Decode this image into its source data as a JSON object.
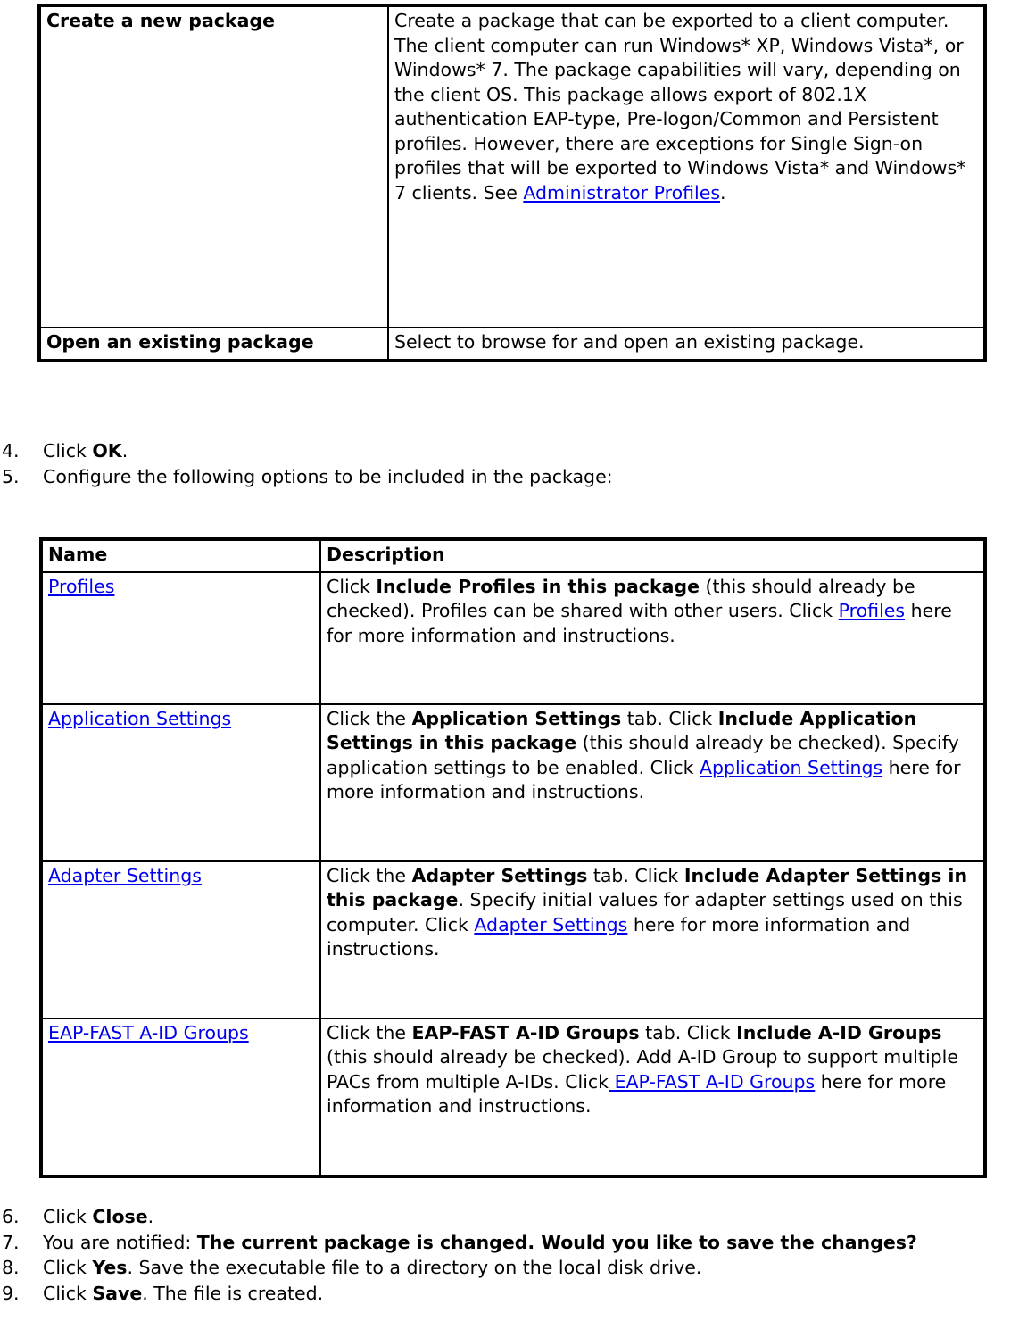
{
  "table_package_options": {
    "rows": [
      {
        "name": "Create a new package",
        "description_part1": "Create a package that can be exported to a client computer. The client computer can run Windows* XP, Windows Vista*, or Windows* 7. The package capabilities will vary, depending on the client OS. This package allows export of 802.1X authentication EAP-type, Pre-logon/Common and Persistent profiles. However, there are exceptions for Single Sign-on profiles that will be exported to Windows Vista* and Windows* 7 clients. See ",
        "description_link": "Administrator Profiles",
        "description_part2": "."
      },
      {
        "name": "Open an existing package",
        "description_part1": "Select to browse for and open an existing package.",
        "description_link": "",
        "description_part2": ""
      }
    ]
  },
  "steps_top": [
    {
      "num": "4.",
      "pre": "Click ",
      "bold": "OK",
      "post": "."
    },
    {
      "num": "5.",
      "pre": "Configure the following options to be included in the package:",
      "bold": "",
      "post": ""
    }
  ],
  "table_package_contents": {
    "headers": {
      "name": "Name",
      "description": "Description"
    },
    "rows": [
      {
        "name_link": "Profiles",
        "seg1": "Click ",
        "bold1": "Include Profiles in this package",
        "seg2": " (this should already be checked). Profiles can be shared with other users. Click ",
        "link": "Profiles",
        "seg3": " here for more information and instructions."
      },
      {
        "name_link": "Application Settings",
        "seg1": "Click the ",
        "bold1": "Application Settings",
        "seg1b": " tab. Click ",
        "bold2": "Include Application Settings in this package",
        "seg2": " (this should already be checked). Specify application settings to be enabled. Click ",
        "link": "Application Settings",
        "seg3": " here for more information and instructions."
      },
      {
        "name_link": "Adapter Settings",
        "seg1": "Click the ",
        "bold1": "Adapter Settings",
        "seg1b": " tab. Click ",
        "bold2": "Include Adapter Settings in this package",
        "seg2": ". Specify initial values for adapter settings used on this computer. Click ",
        "link": "Adapter Settings",
        "seg3": " here for more information and instructions."
      },
      {
        "name_link": "EAP-FAST A-ID Groups",
        "seg1": "Click the ",
        "bold1": "EAP-FAST A-ID Groups",
        "seg1b": " tab. Click ",
        "bold2": "Include A-ID Groups",
        "seg2": " (this should already be checked). Add A-ID Group to support multiple PACs from multiple A-IDs. Click",
        "link": " EAP-FAST A-ID Groups",
        "seg3": " here for more information and instructions."
      }
    ]
  },
  "steps_bottom": [
    {
      "num": "6.",
      "pre": "Click ",
      "bold": "Close",
      "post": "."
    },
    {
      "num": "7.",
      "pre": "You are notified: ",
      "bold": "The current package is changed. Would you like to save the changes?",
      "post": ""
    },
    {
      "num": "8.",
      "pre": "Click ",
      "bold": "Yes",
      "post": ". Save the executable file to a directory on the local disk drive."
    },
    {
      "num": "9.",
      "pre": "Click ",
      "bold": "Save",
      "post": ". The file is created."
    }
  ],
  "colors": {
    "link": "#0000ee",
    "text": "#000000",
    "border": "#000000",
    "background": "#ffffff"
  }
}
